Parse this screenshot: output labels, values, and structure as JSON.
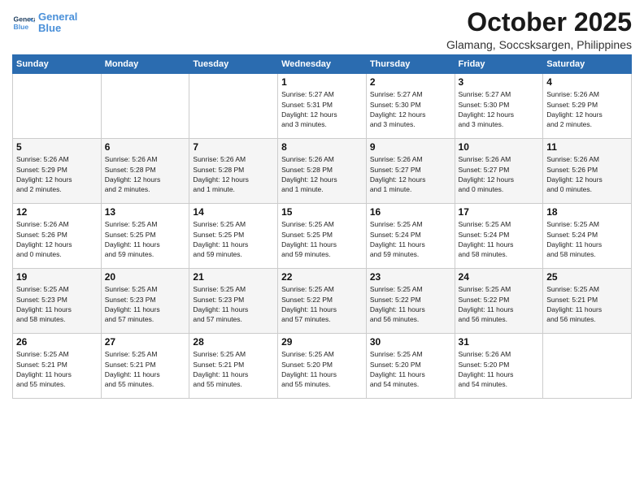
{
  "header": {
    "logo_line1": "General",
    "logo_line2": "Blue",
    "month": "October 2025",
    "location": "Glamang, Soccsksargen, Philippines"
  },
  "weekdays": [
    "Sunday",
    "Monday",
    "Tuesday",
    "Wednesday",
    "Thursday",
    "Friday",
    "Saturday"
  ],
  "weeks": [
    [
      {
        "day": "",
        "info": ""
      },
      {
        "day": "",
        "info": ""
      },
      {
        "day": "",
        "info": ""
      },
      {
        "day": "1",
        "info": "Sunrise: 5:27 AM\nSunset: 5:31 PM\nDaylight: 12 hours\nand 3 minutes."
      },
      {
        "day": "2",
        "info": "Sunrise: 5:27 AM\nSunset: 5:30 PM\nDaylight: 12 hours\nand 3 minutes."
      },
      {
        "day": "3",
        "info": "Sunrise: 5:27 AM\nSunset: 5:30 PM\nDaylight: 12 hours\nand 3 minutes."
      },
      {
        "day": "4",
        "info": "Sunrise: 5:26 AM\nSunset: 5:29 PM\nDaylight: 12 hours\nand 2 minutes."
      }
    ],
    [
      {
        "day": "5",
        "info": "Sunrise: 5:26 AM\nSunset: 5:29 PM\nDaylight: 12 hours\nand 2 minutes."
      },
      {
        "day": "6",
        "info": "Sunrise: 5:26 AM\nSunset: 5:28 PM\nDaylight: 12 hours\nand 2 minutes."
      },
      {
        "day": "7",
        "info": "Sunrise: 5:26 AM\nSunset: 5:28 PM\nDaylight: 12 hours\nand 1 minute."
      },
      {
        "day": "8",
        "info": "Sunrise: 5:26 AM\nSunset: 5:28 PM\nDaylight: 12 hours\nand 1 minute."
      },
      {
        "day": "9",
        "info": "Sunrise: 5:26 AM\nSunset: 5:27 PM\nDaylight: 12 hours\nand 1 minute."
      },
      {
        "day": "10",
        "info": "Sunrise: 5:26 AM\nSunset: 5:27 PM\nDaylight: 12 hours\nand 0 minutes."
      },
      {
        "day": "11",
        "info": "Sunrise: 5:26 AM\nSunset: 5:26 PM\nDaylight: 12 hours\nand 0 minutes."
      }
    ],
    [
      {
        "day": "12",
        "info": "Sunrise: 5:26 AM\nSunset: 5:26 PM\nDaylight: 12 hours\nand 0 minutes."
      },
      {
        "day": "13",
        "info": "Sunrise: 5:25 AM\nSunset: 5:25 PM\nDaylight: 11 hours\nand 59 minutes."
      },
      {
        "day": "14",
        "info": "Sunrise: 5:25 AM\nSunset: 5:25 PM\nDaylight: 11 hours\nand 59 minutes."
      },
      {
        "day": "15",
        "info": "Sunrise: 5:25 AM\nSunset: 5:25 PM\nDaylight: 11 hours\nand 59 minutes."
      },
      {
        "day": "16",
        "info": "Sunrise: 5:25 AM\nSunset: 5:24 PM\nDaylight: 11 hours\nand 59 minutes."
      },
      {
        "day": "17",
        "info": "Sunrise: 5:25 AM\nSunset: 5:24 PM\nDaylight: 11 hours\nand 58 minutes."
      },
      {
        "day": "18",
        "info": "Sunrise: 5:25 AM\nSunset: 5:24 PM\nDaylight: 11 hours\nand 58 minutes."
      }
    ],
    [
      {
        "day": "19",
        "info": "Sunrise: 5:25 AM\nSunset: 5:23 PM\nDaylight: 11 hours\nand 58 minutes."
      },
      {
        "day": "20",
        "info": "Sunrise: 5:25 AM\nSunset: 5:23 PM\nDaylight: 11 hours\nand 57 minutes."
      },
      {
        "day": "21",
        "info": "Sunrise: 5:25 AM\nSunset: 5:23 PM\nDaylight: 11 hours\nand 57 minutes."
      },
      {
        "day": "22",
        "info": "Sunrise: 5:25 AM\nSunset: 5:22 PM\nDaylight: 11 hours\nand 57 minutes."
      },
      {
        "day": "23",
        "info": "Sunrise: 5:25 AM\nSunset: 5:22 PM\nDaylight: 11 hours\nand 56 minutes."
      },
      {
        "day": "24",
        "info": "Sunrise: 5:25 AM\nSunset: 5:22 PM\nDaylight: 11 hours\nand 56 minutes."
      },
      {
        "day": "25",
        "info": "Sunrise: 5:25 AM\nSunset: 5:21 PM\nDaylight: 11 hours\nand 56 minutes."
      }
    ],
    [
      {
        "day": "26",
        "info": "Sunrise: 5:25 AM\nSunset: 5:21 PM\nDaylight: 11 hours\nand 55 minutes."
      },
      {
        "day": "27",
        "info": "Sunrise: 5:25 AM\nSunset: 5:21 PM\nDaylight: 11 hours\nand 55 minutes."
      },
      {
        "day": "28",
        "info": "Sunrise: 5:25 AM\nSunset: 5:21 PM\nDaylight: 11 hours\nand 55 minutes."
      },
      {
        "day": "29",
        "info": "Sunrise: 5:25 AM\nSunset: 5:20 PM\nDaylight: 11 hours\nand 55 minutes."
      },
      {
        "day": "30",
        "info": "Sunrise: 5:25 AM\nSunset: 5:20 PM\nDaylight: 11 hours\nand 54 minutes."
      },
      {
        "day": "31",
        "info": "Sunrise: 5:26 AM\nSunset: 5:20 PM\nDaylight: 11 hours\nand 54 minutes."
      },
      {
        "day": "",
        "info": ""
      }
    ]
  ]
}
